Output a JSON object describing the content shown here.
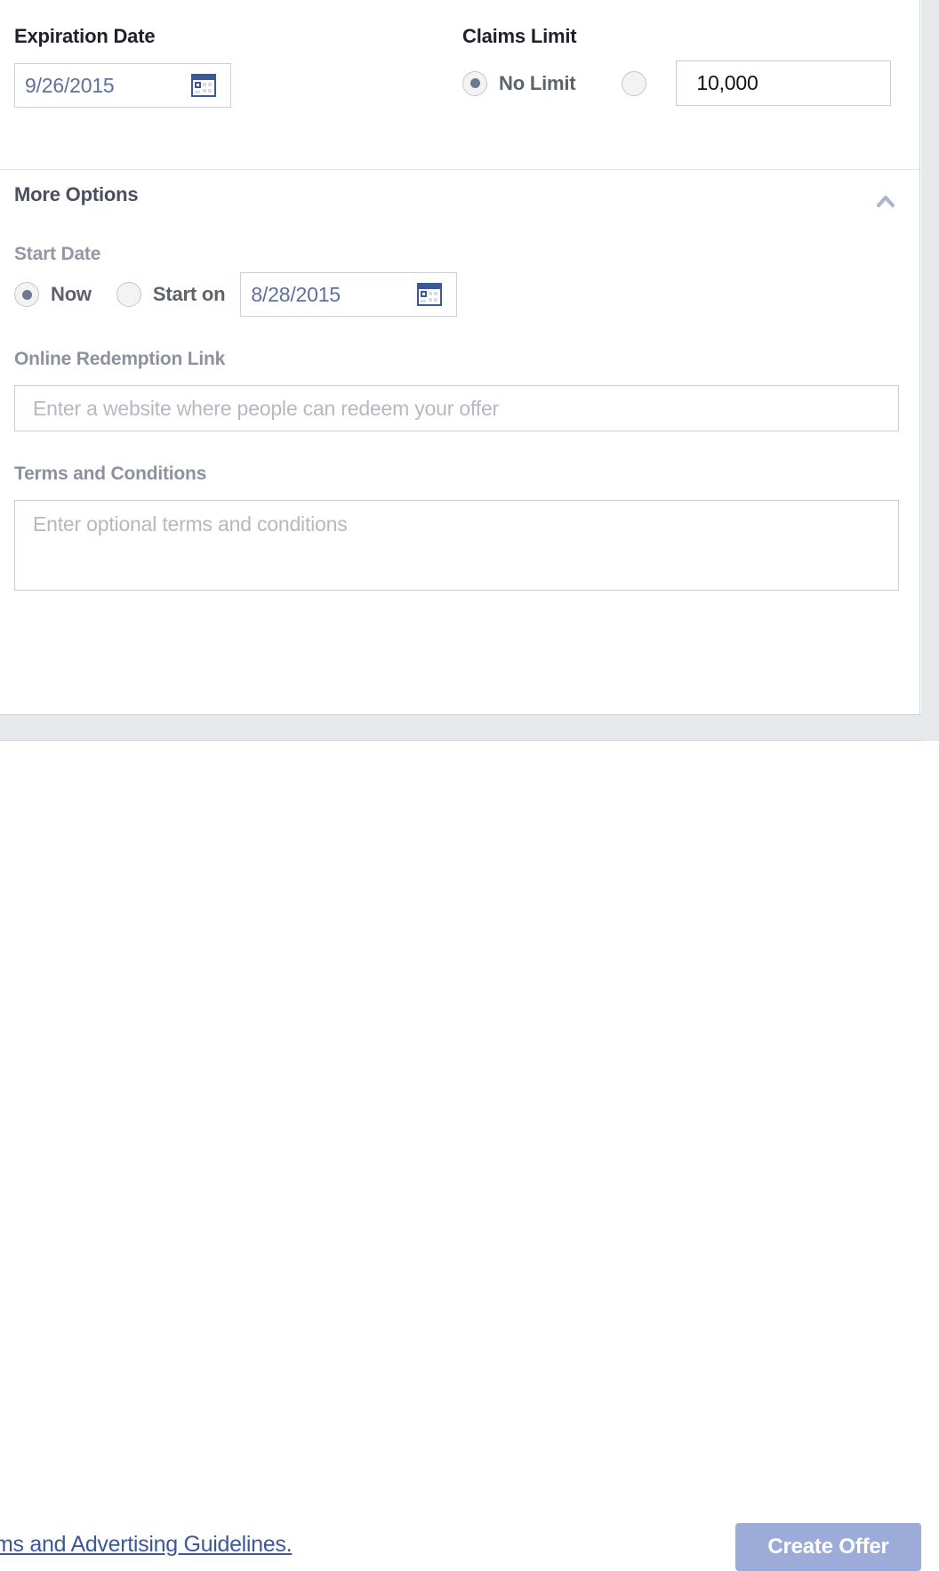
{
  "dialog": {
    "expiration": {
      "title": "Expiration Date",
      "date_value": "9/26/2015",
      "calendar_icon": "calendar-icon"
    },
    "claims_limit": {
      "title": "Claims Limit",
      "no_limit_label": "No Limit",
      "limit_value": "10,000"
    },
    "more_options": {
      "title": "More Options",
      "collapse_icon": "chevron-up-icon",
      "start_date": {
        "label": "Start Date",
        "now_label": "Now",
        "start_on_label": "Start on",
        "date_value": "8/28/2015",
        "calendar_icon": "calendar-icon"
      },
      "redemption": {
        "label": "Online Redemption Link",
        "placeholder": "Enter a website where people can redeem your offer",
        "value": ""
      },
      "terms": {
        "label": "Terms and Conditions",
        "placeholder": "Enter optional terms and conditions",
        "value": ""
      }
    }
  },
  "footer": {
    "link_text": "ms and Advertising Guidelines",
    "link_suffix": ".",
    "create_button": "Create Offer"
  },
  "colors": {
    "accent_link": "#3b5998",
    "button_disabled": "#9cabd8",
    "date_text": "#5f6f9e",
    "panel_chrome": "#e7e8ec"
  }
}
